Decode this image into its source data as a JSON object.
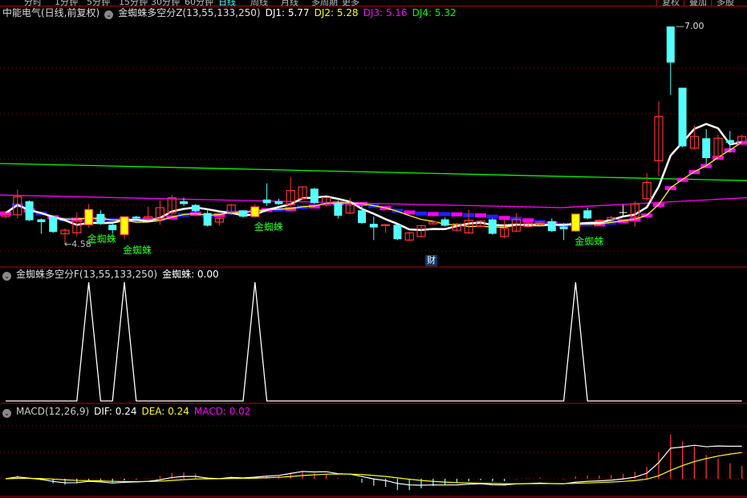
{
  "toolbar": {
    "periods": [
      "分时",
      "1分钟",
      "5分钟",
      "15分钟",
      "30分钟",
      "60分钟",
      "日线",
      "周线",
      "月线",
      "多周期",
      "更多"
    ],
    "active_period": "日线",
    "buttons": [
      "复权",
      "叠加",
      "多股"
    ]
  },
  "main_panel": {
    "title": "中能电气(日线,前复权)",
    "indicator": "金蜘蛛多空分Z(13,55,133,250)",
    "dj1": "DJ1: 5.77",
    "dj2": "DJ2: 5.28",
    "dj3": "DJ3: 5.16",
    "dj4": "DJ4: 5.32",
    "high_label": "7.00",
    "low_label": "←4.58",
    "signal_label": "金蜘蛛",
    "finance_marker": "财"
  },
  "f_panel": {
    "indicator": "金蜘蛛多空分F(13,55,133,250)",
    "value": "金蜘蛛: 0.00"
  },
  "macd_panel": {
    "indicator": "MACD(12,26,9)",
    "dif": "DIF: 0.24",
    "dea": "DEA: 0.24",
    "macd": "MACD: 0.02"
  },
  "colors": {
    "up": "#ff3333",
    "down": "#54ffff",
    "signal": "#ffff00",
    "dj1": "#ffffff",
    "dj2": "#ffff00",
    "dj3": "#ff00ff",
    "dj4": "#00ff00",
    "grid": "#a00000"
  },
  "chart_data": {
    "type": "candlestick",
    "price_range": [
      4.58,
      7.0
    ],
    "candles_ohlc": [
      [
        4.89,
        4.94,
        4.87,
        4.93
      ],
      [
        4.91,
        5.19,
        4.87,
        5.11
      ],
      [
        5.06,
        5.07,
        4.84,
        4.85
      ],
      [
        4.86,
        4.87,
        4.7,
        4.83
      ],
      [
        4.89,
        4.9,
        4.71,
        4.72
      ],
      [
        4.7,
        4.76,
        4.58,
        4.74
      ],
      [
        4.71,
        4.94,
        4.67,
        4.85
      ],
      [
        4.8,
        5.03,
        4.77,
        4.97
      ],
      [
        4.92,
        4.96,
        4.8,
        4.81
      ],
      [
        4.8,
        4.82,
        4.7,
        4.74
      ],
      [
        4.69,
        4.89,
        4.64,
        4.89
      ],
      [
        4.89,
        4.9,
        4.86,
        4.87
      ],
      [
        4.86,
        5.0,
        4.85,
        4.89
      ],
      [
        4.87,
        5.07,
        4.8,
        4.99
      ],
      [
        4.93,
        5.13,
        4.91,
        5.1
      ],
      [
        5.06,
        5.1,
        5.01,
        5.03
      ],
      [
        5.02,
        5.03,
        4.94,
        4.95
      ],
      [
        4.93,
        4.97,
        4.78,
        4.79
      ],
      [
        4.83,
        4.89,
        4.79,
        4.87
      ],
      [
        4.94,
        5.03,
        4.91,
        5.02
      ],
      [
        4.96,
        4.96,
        4.88,
        4.89
      ],
      [
        4.89,
        5.03,
        4.88,
        5.0
      ],
      [
        5.08,
        5.26,
        5.01,
        5.04
      ],
      [
        5.06,
        5.09,
        5.02,
        5.03
      ],
      [
        5.02,
        5.33,
        5.0,
        5.18
      ],
      [
        5.09,
        5.22,
        5.08,
        5.22
      ],
      [
        5.2,
        5.21,
        5.03,
        5.04
      ],
      [
        5.02,
        5.1,
        5.0,
        5.1
      ],
      [
        5.04,
        5.07,
        4.87,
        4.9
      ],
      [
        4.93,
        5.1,
        4.92,
        5.02
      ],
      [
        4.96,
        5.01,
        4.81,
        4.82
      ],
      [
        4.81,
        4.89,
        4.63,
        4.77
      ],
      [
        4.79,
        4.81,
        4.71,
        4.8
      ],
      [
        4.8,
        4.81,
        4.63,
        4.64
      ],
      [
        4.63,
        4.72,
        4.62,
        4.71
      ],
      [
        4.67,
        4.8,
        4.66,
        4.79
      ],
      [
        4.81,
        4.84,
        4.8,
        4.83
      ],
      [
        4.86,
        4.88,
        4.78,
        4.79
      ],
      [
        4.74,
        4.82,
        4.73,
        4.81
      ],
      [
        4.71,
        4.97,
        4.7,
        4.85
      ],
      [
        4.78,
        4.85,
        4.77,
        4.84
      ],
      [
        4.86,
        4.87,
        4.69,
        4.7
      ],
      [
        4.67,
        4.88,
        4.65,
        4.76
      ],
      [
        4.73,
        4.93,
        4.72,
        4.86
      ],
      [
        4.78,
        4.83,
        4.77,
        4.82
      ],
      [
        4.8,
        4.84,
        4.79,
        4.83
      ],
      [
        4.84,
        4.87,
        4.72,
        4.73
      ],
      [
        4.78,
        4.82,
        4.63,
        4.75
      ],
      [
        4.73,
        4.92,
        4.72,
        4.92
      ],
      [
        4.96,
        4.99,
        4.86,
        4.87
      ],
      [
        4.84,
        4.86,
        4.83,
        4.85
      ],
      [
        4.86,
        4.9,
        4.85,
        4.88
      ],
      [
        4.94,
        5.02,
        4.89,
        4.94
      ],
      [
        4.89,
        5.06,
        4.78,
        5.03
      ],
      [
        5.09,
        5.37,
        5.07,
        5.27
      ],
      [
        5.51,
        6.17,
        5.34,
        6.0
      ],
      [
        7.0,
        7.0,
        6.24,
        6.6
      ],
      [
        6.32,
        6.32,
        5.66,
        5.67
      ],
      [
        5.65,
        5.9,
        5.64,
        5.78
      ],
      [
        5.76,
        5.86,
        5.47,
        5.54
      ],
      [
        5.55,
        5.8,
        5.54,
        5.76
      ],
      [
        5.74,
        5.84,
        5.6,
        5.71
      ],
      [
        5.7,
        5.8,
        5.69,
        5.78
      ]
    ],
    "signal_indices": [
      7,
      10,
      21,
      48
    ],
    "dj4_line": [
      5.48,
      5.29
    ],
    "dj3_line": [
      5.13,
      4.99,
      5.1
    ]
  }
}
